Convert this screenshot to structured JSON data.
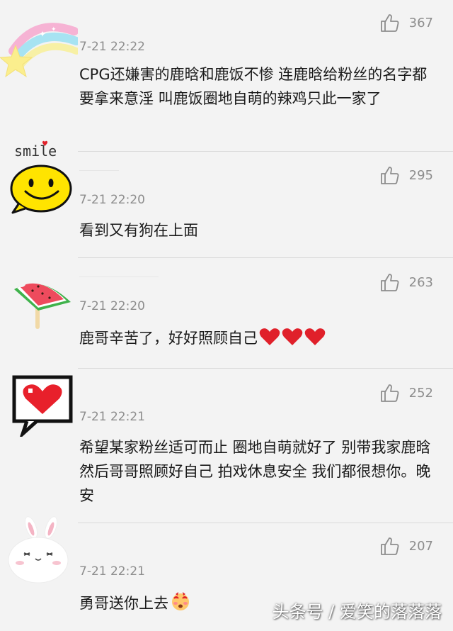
{
  "comments": [
    {
      "time": "7-21 22:22",
      "likes": "367",
      "text": "CPG还嫌害的鹿晗和鹿饭不惨 连鹿晗给粉丝的名字都要拿来意淫 叫鹿饭圈地自萌的辣鸡只此一家了"
    },
    {
      "time": "7-21 22:20",
      "likes": "295",
      "text": "看到又有狗在上面"
    },
    {
      "time": "7-21 22:20",
      "likes": "263",
      "text": "鹿哥辛苦了，好好照顾自己"
    },
    {
      "time": "7-21 22:21",
      "likes": "252",
      "text": "希望某家粉丝适可而止 圈地自萌就好了 别带我家鹿晗  然后哥哥照顾好自己 拍戏休息安全 我们都很想你。晚安"
    },
    {
      "time": "7-21 22:21",
      "likes": "207",
      "text": "勇哥送你上去"
    }
  ],
  "avatars": {
    "smile_label": "smile"
  },
  "watermark": "头条号 / 爱笑的落落落",
  "colors": {
    "background": "#f3f3f3",
    "meta_gray": "#8d8d8d",
    "heart_red": "#e0202a"
  },
  "icons": [
    "star-rainbow-avatar",
    "smile-avatar",
    "watermelon-popsicle-avatar",
    "pixel-heart-avatar",
    "bunny-avatar",
    "thumbs-up-icon",
    "heart-emoji-icon",
    "blush-emoji-icon"
  ]
}
